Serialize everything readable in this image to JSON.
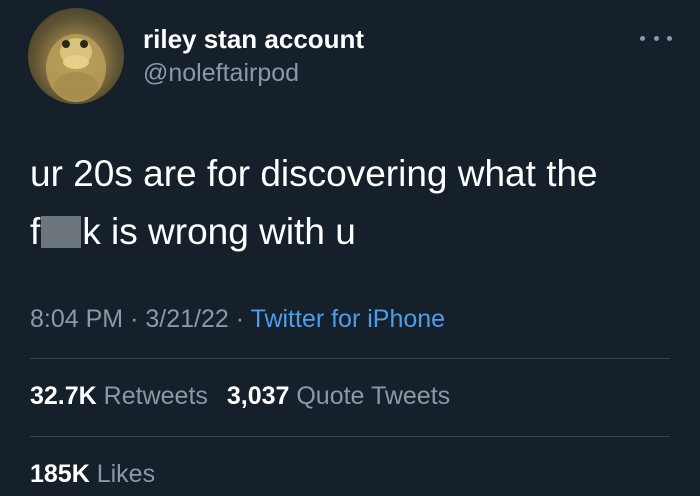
{
  "tweet": {
    "display_name": "riley stan account",
    "handle": "@noleftairpod",
    "text_line1": "ur 20s are for discovering what the",
    "text_line2_start": "f",
    "text_line2_end": "k is wrong with u",
    "time": "8:04 PM",
    "separator": "·",
    "date": "3/21/22",
    "source": "Twitter for iPhone"
  },
  "stats": {
    "retweets_count": "32.7K",
    "retweets_label": "Retweets",
    "quotes_count": "3,037",
    "quotes_label": "Quote Tweets",
    "likes_count": "185K",
    "likes_label": "Likes"
  },
  "icons": {
    "more": "more-horizontal-icon",
    "avatar": "profile-avatar"
  },
  "colors": {
    "background": "#15202b",
    "secondary_text": "#8b98a5",
    "link": "#4a9eea",
    "divider": "#38444d"
  }
}
